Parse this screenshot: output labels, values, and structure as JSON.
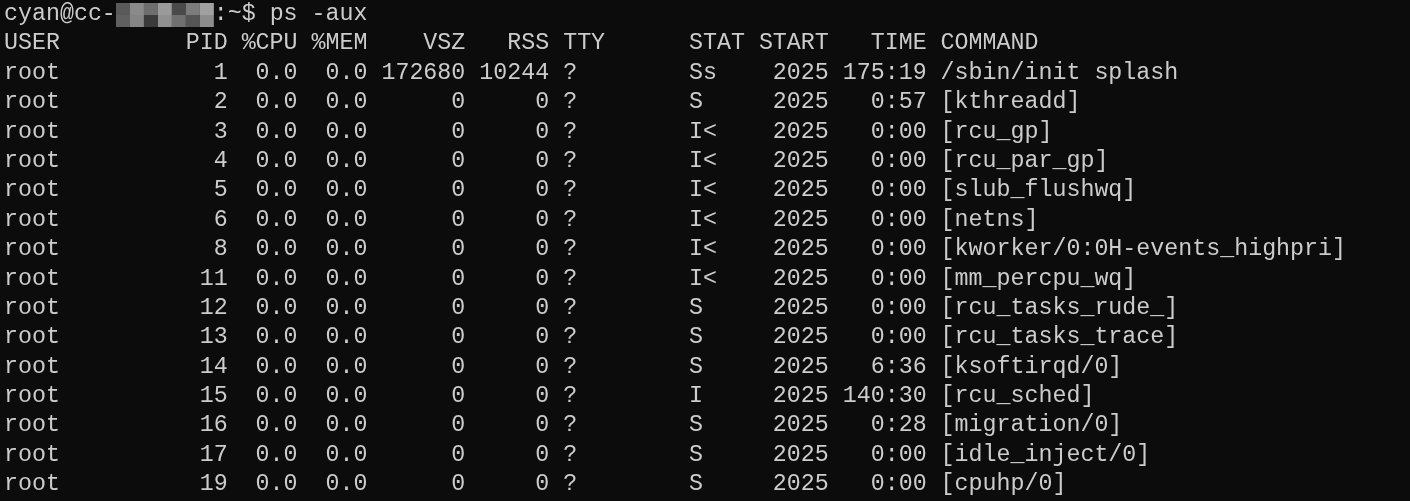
{
  "prompt": {
    "host_prefix": "cyan@cc-",
    "suffix": ":~$",
    "command": "ps -aux"
  },
  "columns": [
    "USER",
    "PID",
    "%CPU",
    "%MEM",
    "VSZ",
    "RSS",
    "TTY",
    "STAT",
    "START",
    "TIME",
    "COMMAND"
  ],
  "rows": [
    [
      "root",
      "1",
      "0.0",
      "0.0",
      "172680",
      "10244",
      "?",
      "Ss",
      "2025",
      "175:19",
      "/sbin/init splash"
    ],
    [
      "root",
      "2",
      "0.0",
      "0.0",
      "0",
      "0",
      "?",
      "S",
      "2025",
      "0:57",
      "[kthreadd]"
    ],
    [
      "root",
      "3",
      "0.0",
      "0.0",
      "0",
      "0",
      "?",
      "I<",
      "2025",
      "0:00",
      "[rcu_gp]"
    ],
    [
      "root",
      "4",
      "0.0",
      "0.0",
      "0",
      "0",
      "?",
      "I<",
      "2025",
      "0:00",
      "[rcu_par_gp]"
    ],
    [
      "root",
      "5",
      "0.0",
      "0.0",
      "0",
      "0",
      "?",
      "I<",
      "2025",
      "0:00",
      "[slub_flushwq]"
    ],
    [
      "root",
      "6",
      "0.0",
      "0.0",
      "0",
      "0",
      "?",
      "I<",
      "2025",
      "0:00",
      "[netns]"
    ],
    [
      "root",
      "8",
      "0.0",
      "0.0",
      "0",
      "0",
      "?",
      "I<",
      "2025",
      "0:00",
      "[kworker/0:0H-events_highpri]"
    ],
    [
      "root",
      "11",
      "0.0",
      "0.0",
      "0",
      "0",
      "?",
      "I<",
      "2025",
      "0:00",
      "[mm_percpu_wq]"
    ],
    [
      "root",
      "12",
      "0.0",
      "0.0",
      "0",
      "0",
      "?",
      "S",
      "2025",
      "0:00",
      "[rcu_tasks_rude_]"
    ],
    [
      "root",
      "13",
      "0.0",
      "0.0",
      "0",
      "0",
      "?",
      "S",
      "2025",
      "0:00",
      "[rcu_tasks_trace]"
    ],
    [
      "root",
      "14",
      "0.0",
      "0.0",
      "0",
      "0",
      "?",
      "S",
      "2025",
      "6:36",
      "[ksoftirqd/0]"
    ],
    [
      "root",
      "15",
      "0.0",
      "0.0",
      "0",
      "0",
      "?",
      "I",
      "2025",
      "140:30",
      "[rcu_sched]"
    ],
    [
      "root",
      "16",
      "0.0",
      "0.0",
      "0",
      "0",
      "?",
      "S",
      "2025",
      "0:28",
      "[migration/0]"
    ],
    [
      "root",
      "17",
      "0.0",
      "0.0",
      "0",
      "0",
      "?",
      "S",
      "2025",
      "0:00",
      "[idle_inject/0]"
    ],
    [
      "root",
      "19",
      "0.0",
      "0.0",
      "0",
      "0",
      "?",
      "S",
      "2025",
      "0:00",
      "[cpuhp/0]"
    ]
  ]
}
